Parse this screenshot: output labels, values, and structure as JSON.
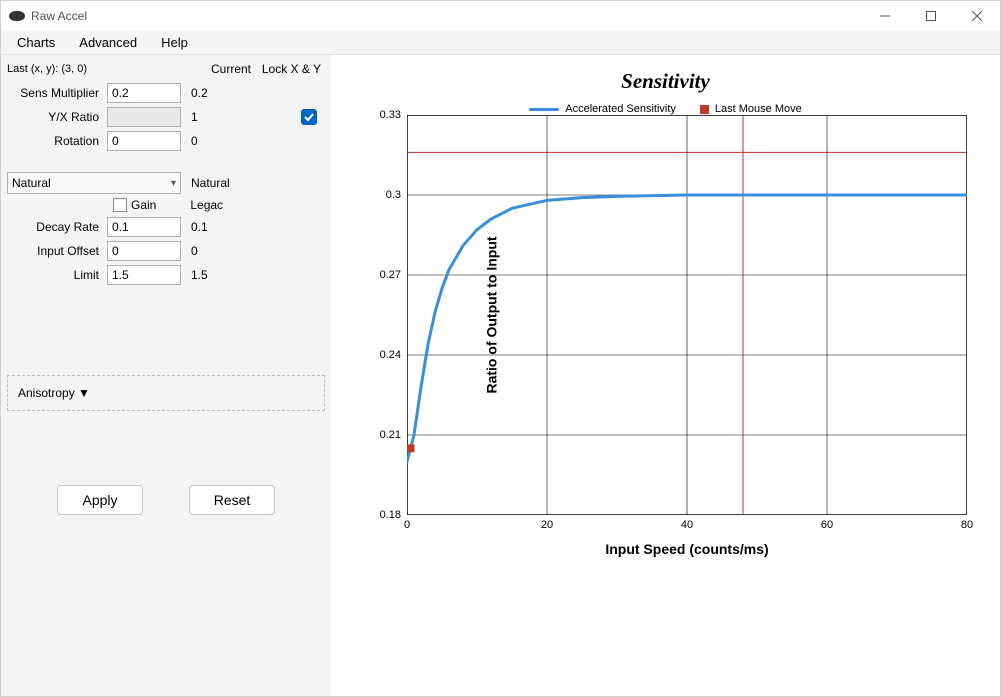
{
  "window": {
    "title": "Raw Accel"
  },
  "menubar": {
    "charts": "Charts",
    "advanced": "Advanced",
    "help": "Help"
  },
  "panel": {
    "last_xy_label": "Last (x, y): (3, 0)",
    "current_header": "Current",
    "lock_header": "Lock X & Y",
    "sens_multiplier": {
      "label": "Sens Multiplier",
      "value": "0.2",
      "current": "0.2"
    },
    "yx_ratio": {
      "label": "Y/X Ratio",
      "value": "",
      "current": "1"
    },
    "rotation": {
      "label": "Rotation",
      "value": "0",
      "current": "0"
    },
    "mode": {
      "selected": "Natural",
      "current": "Natural"
    },
    "gain": {
      "label": "Gain",
      "current": "Legac"
    },
    "decay_rate": {
      "label": "Decay Rate",
      "value": "0.1",
      "current": "0.1"
    },
    "input_offset": {
      "label": "Input Offset",
      "value": "0",
      "current": "0"
    },
    "limit": {
      "label": "Limit",
      "value": "1.5",
      "current": "1.5"
    },
    "anisotropy": "Anisotropy ▼",
    "apply": "Apply",
    "reset": "Reset"
  },
  "chart_data": {
    "type": "line",
    "title": "Sensitivity",
    "xlabel": "Input Speed (counts/ms)",
    "ylabel": "Ratio of Output to Input",
    "xlim": [
      0,
      80
    ],
    "ylim": [
      0.18,
      0.33
    ],
    "x_ticks": [
      0,
      20,
      40,
      60,
      80
    ],
    "y_ticks": [
      0.18,
      0.21,
      0.24,
      0.27,
      0.3,
      0.33
    ],
    "series": [
      {
        "name": "Accelerated Sensitivity",
        "color": "#3b8fd9",
        "x": [
          0,
          1,
          2,
          3,
          4,
          5,
          6,
          8,
          10,
          12,
          15,
          20,
          25,
          30,
          40,
          60,
          80
        ],
        "values": [
          0.2,
          0.21,
          0.228,
          0.244,
          0.256,
          0.265,
          0.272,
          0.281,
          0.287,
          0.291,
          0.295,
          0.298,
          0.299,
          0.2995,
          0.3,
          0.3,
          0.3
        ]
      }
    ],
    "last_move_marker": {
      "x": 0.5,
      "y": 0.205,
      "color": "#c0392b"
    },
    "crosshair": {
      "x": 48,
      "y": 0.316,
      "color": "#bb3030"
    },
    "legend": {
      "accelerated": "Accelerated Sensitivity",
      "last_move": "Last Mouse Move"
    }
  }
}
